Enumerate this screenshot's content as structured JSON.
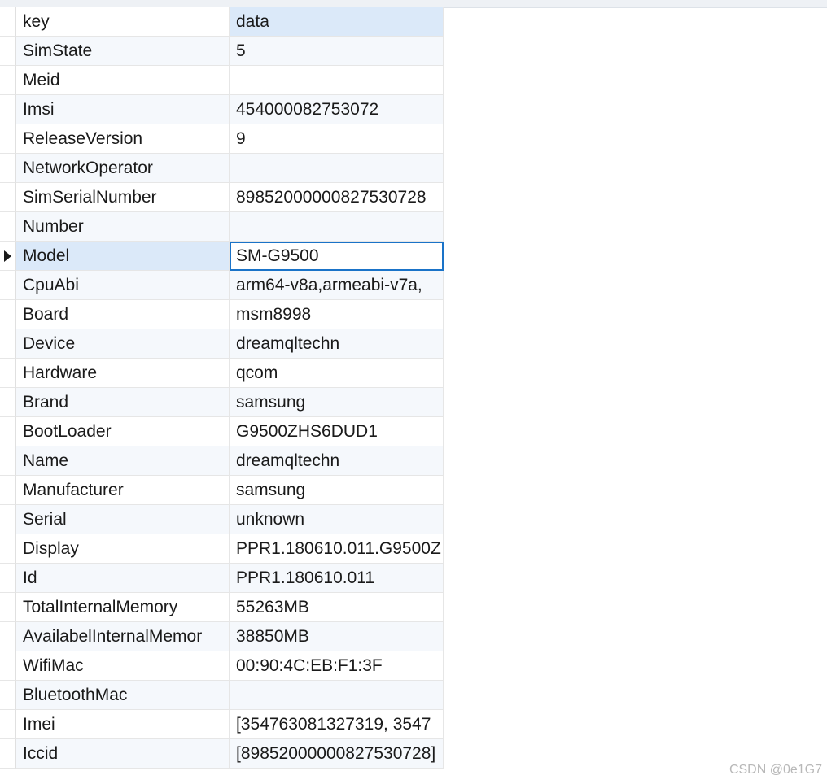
{
  "header": {
    "key": "key",
    "data": "data"
  },
  "selected_index": 8,
  "rows": [
    {
      "key": "SimState",
      "data": "5"
    },
    {
      "key": "Meid",
      "data": ""
    },
    {
      "key": "Imsi",
      "data": "454000082753072"
    },
    {
      "key": "ReleaseVersion",
      "data": "9"
    },
    {
      "key": "NetworkOperator",
      "data": ""
    },
    {
      "key": "SimSerialNumber",
      "data": "89852000000827530728"
    },
    {
      "key": "Number",
      "data": ""
    },
    {
      "key": "Model",
      "data": "SM-G9500"
    },
    {
      "key": "CpuAbi",
      "data": "arm64-v8a,armeabi-v7a,"
    },
    {
      "key": "Board",
      "data": "msm8998"
    },
    {
      "key": "Device",
      "data": "dreamqltechn"
    },
    {
      "key": "Hardware",
      "data": "qcom"
    },
    {
      "key": "Brand",
      "data": "samsung"
    },
    {
      "key": "BootLoader",
      "data": "G9500ZHS6DUD1"
    },
    {
      "key": "Name",
      "data": "dreamqltechn"
    },
    {
      "key": "Manufacturer",
      "data": "samsung"
    },
    {
      "key": "Serial",
      "data": "unknown"
    },
    {
      "key": "Display",
      "data": "PPR1.180610.011.G9500Z"
    },
    {
      "key": "Id",
      "data": "PPR1.180610.011"
    },
    {
      "key": "TotalInternalMemory",
      "data": "55263MB"
    },
    {
      "key": "AvailabelInternalMemor",
      "data": "38850MB"
    },
    {
      "key": "WifiMac",
      "data": "00:90:4C:EB:F1:3F"
    },
    {
      "key": "BluetoothMac",
      "data": ""
    },
    {
      "key": "Imei",
      "data": "[354763081327319, 3547"
    },
    {
      "key": "Iccid",
      "data": "[89852000000827530728]"
    }
  ],
  "watermark": "CSDN @0e1G7",
  "icons": {
    "row_pointer": "triangle-right-icon"
  },
  "colors": {
    "selected_row": "#dbe9f9",
    "selected_cell_border": "#1a73c8",
    "alt_row": "#f5f8fc",
    "grid_line": "#e6e6e6"
  }
}
